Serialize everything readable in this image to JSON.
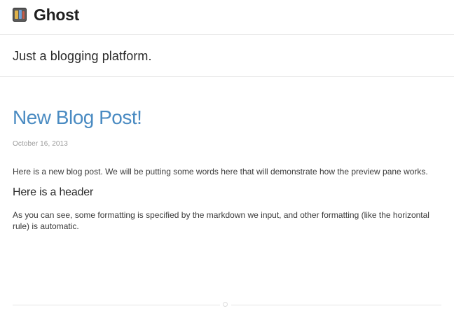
{
  "site": {
    "title": "Ghost",
    "tagline": "Just a blogging platform.",
    "logo_icon": "ghost-logo-icon"
  },
  "post": {
    "title": "New Blog Post!",
    "date": "October 16, 2013",
    "paragraph1": "Here is a new blog post. We will be putting some words here that will demonstrate how the preview pane works.",
    "heading": "Here is a header",
    "paragraph2": "As you can see, some formatting is specified by the markdown we input, and other formatting (like the horizontal rule) is automatic."
  },
  "colors": {
    "title_link": "#4a8bc2",
    "text": "#3a3a3a",
    "muted": "#9a9a9a",
    "rule": "#e6e6e6"
  }
}
